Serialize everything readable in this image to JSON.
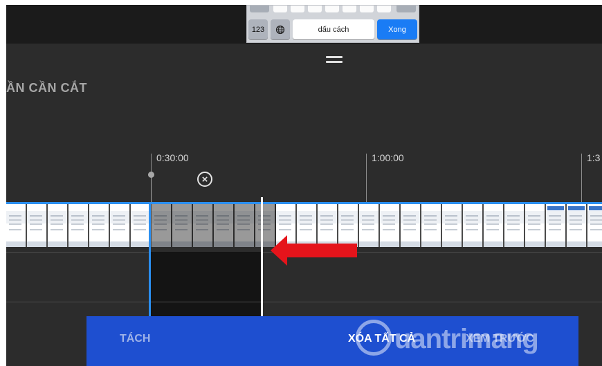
{
  "keyboard": {
    "key_numbers": "123",
    "key_globe_icon": "globe-icon",
    "key_space": "dấu cách",
    "key_done": "Xong"
  },
  "editor": {
    "section_title": "ẦN CẦN CẮT",
    "timeline": {
      "marks": [
        "0:30:00",
        "1:00:00",
        "1:3"
      ]
    },
    "close_glyph": "×"
  },
  "bottom_bar": {
    "split_label": "TÁCH",
    "delete_all_label": "XÓA TẤT CẢ",
    "preview_label": "XEM TRƯỚC"
  },
  "watermark": {
    "text": "uantrimang"
  },
  "colors": {
    "accent_blue": "#2b8ff0",
    "bottom_bar": "#1e4fd0",
    "arrow_red": "#e5141b",
    "done_key": "#1a7cf5"
  }
}
